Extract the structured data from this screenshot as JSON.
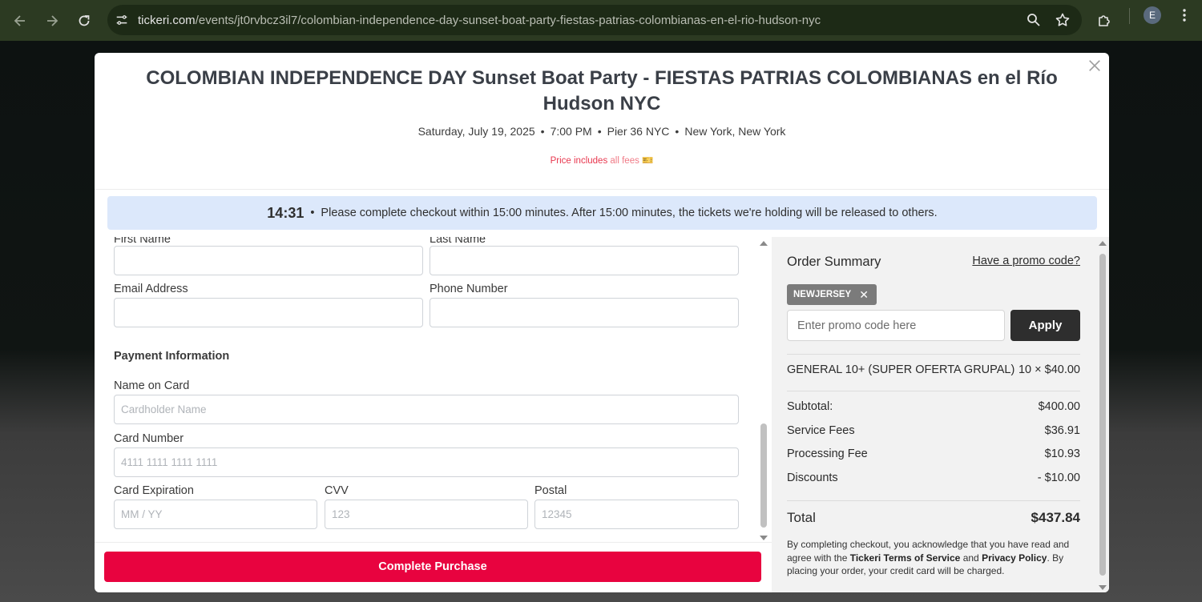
{
  "browser": {
    "url_host": "tickeri.com",
    "url_path": "/events/jt0rvbcz3il7/colombian-independence-day-sunset-boat-party-fiestas-patrias-colombianas-en-el-rio-hudson-nyc",
    "avatar_initial": "E"
  },
  "event": {
    "title": "COLOMBIAN INDEPENDENCE DAY Sunset Boat Party - FIESTAS PATRIAS COLOMBIANAS en el Río Hudson NYC",
    "date": "Saturday, July 19, 2025",
    "time": "7:00 PM",
    "venue": "Pier 36 NYC",
    "location": "New York, New York",
    "fees_note_prefix": "Price includes",
    "fees_note_suffix": "all fees",
    "fees_icon": "🎫"
  },
  "timer": {
    "remaining": "14:31",
    "message": "Please complete checkout within 15:00 minutes. After 15:00 minutes, the tickets we're holding will be released to others."
  },
  "form": {
    "first_name_label": "First Name",
    "last_name_label": "Last Name",
    "email_label": "Email Address",
    "phone_label": "Phone Number",
    "payment_section": "Payment Information",
    "name_on_card_label": "Name on Card",
    "name_on_card_placeholder": "Cardholder Name",
    "card_number_label": "Card Number",
    "card_number_placeholder": "4111 1111 1111 1111",
    "expiration_label": "Card Expiration",
    "expiration_placeholder": "MM / YY",
    "cvv_label": "CVV",
    "cvv_placeholder": "123",
    "postal_label": "Postal",
    "postal_placeholder": "12345",
    "submit_label": "Complete Purchase"
  },
  "summary": {
    "title": "Order Summary",
    "promo_link": "Have a promo code?",
    "applied_code": "NEWJERSEY",
    "promo_placeholder": "Enter promo code here",
    "apply_label": "Apply",
    "ticket_name": "GENERAL 10+ (SUPER OFERTA GRUPAL)",
    "ticket_qty_price": "10 × $40.00",
    "subtotal_label": "Subtotal:",
    "subtotal_value": "$400.00",
    "service_fees_label": "Service Fees",
    "service_fees_value": "$36.91",
    "processing_fee_label": "Processing Fee",
    "processing_fee_value": "$10.93",
    "discounts_label": "Discounts",
    "discounts_value": "- $10.00",
    "total_label": "Total",
    "total_value": "$437.84",
    "legal_1": "By completing checkout, you acknowledge that you have read and agree with the ",
    "legal_tos": "Tickeri Terms of Service",
    "legal_and": " and ",
    "legal_privacy": "Privacy Policy",
    "legal_2": ". By placing your order, your credit card will be charged."
  },
  "colors": {
    "purchase_button": "#e8033f",
    "timer_bg": "#dce8fb",
    "apply_button": "#2e2e2e"
  }
}
